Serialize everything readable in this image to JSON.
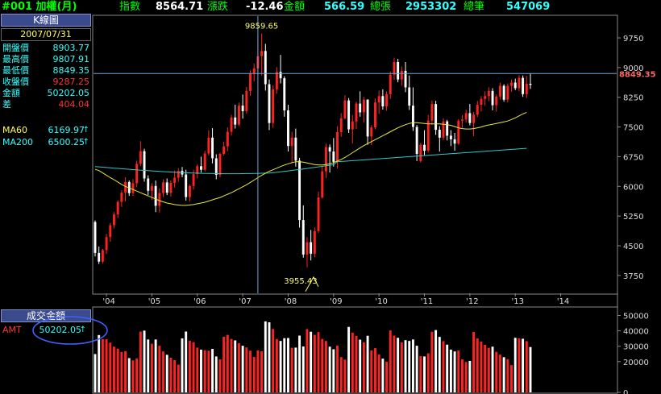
{
  "header": {
    "code_title": "#001 加權(月)",
    "index_label": "指數",
    "index_value": "8564.71",
    "change_label": "漲跌",
    "change_value": "-12.46",
    "amount_label": "金額",
    "amount_value": "566.59",
    "up_count_label": "總張",
    "up_count_value": "2953302",
    "trades_label": "總筆",
    "trades_value": "547069"
  },
  "info_panel": {
    "title": "K線圖",
    "date": "2007/07/31",
    "rows": [
      {
        "label": "開盤價",
        "value": "8903.77"
      },
      {
        "label": "最高價",
        "value": "9807.91"
      },
      {
        "label": "最低價",
        "value": "8849.35"
      },
      {
        "label": "收盤價",
        "value": "9287.25"
      },
      {
        "label": "金額",
        "value": "50202.05"
      },
      {
        "label": "差",
        "value": "404.04"
      }
    ],
    "ma60_label": "MA60",
    "ma60_value": "6169.97",
    "ma200_label": "MA200",
    "ma200_value": "6500.25",
    "arrow": "↑"
  },
  "volume_panel": {
    "title": "成交金額",
    "amt_label": "AMT",
    "amt_value": "50202.05",
    "arrow": "↑"
  },
  "colors": {
    "up": "#ff2222",
    "down": "#ffffff",
    "ma60": "#e8e840",
    "ma200": "#30c8c8",
    "grid": "#555555",
    "crosshair": "#6fa8dc",
    "annotation": "#ffff66",
    "highlight_ellipse": "#4060ff"
  },
  "chart_data": {
    "type": "candlestick",
    "price_axis": {
      "ticks": [
        3750,
        4500,
        5250,
        6000,
        6750,
        7500,
        8250,
        9000,
        9750
      ],
      "range": [
        3300,
        10300
      ]
    },
    "volume_axis": {
      "ticks": [
        0,
        20000,
        30000,
        40000,
        50000
      ],
      "range": [
        0,
        55000
      ]
    },
    "x_ticks": [
      "'04",
      "'05",
      "'06",
      "'07",
      "'08",
      "'09",
      "'10",
      "'11",
      "'12",
      "'13",
      "'14"
    ],
    "annotations": {
      "high": "9859.65",
      "low": "3955.43",
      "current_price": "8849.35"
    },
    "candles_ohlc": [
      [
        5100,
        5140,
        4230,
        4320
      ],
      [
        4320,
        4480,
        4040,
        4100
      ],
      [
        4100,
        4420,
        4050,
        4390
      ],
      [
        4390,
        4800,
        4290,
        4720
      ],
      [
        4720,
        5080,
        4600,
        5020
      ],
      [
        5020,
        5350,
        4940,
        5290
      ],
      [
        5290,
        5650,
        5200,
        5610
      ],
      [
        5610,
        5900,
        5480,
        5840
      ],
      [
        5840,
        6230,
        5620,
        6110
      ],
      [
        6110,
        6150,
        5760,
        5830
      ],
      [
        5830,
        6180,
        5760,
        6080
      ],
      [
        6080,
        6650,
        5980,
        6570
      ],
      [
        6570,
        7140,
        6510,
        6890
      ],
      [
        6890,
        6950,
        6120,
        6200
      ],
      [
        6200,
        6280,
        5780,
        5890
      ],
      [
        5890,
        6080,
        5660,
        6010
      ],
      [
        6010,
        6150,
        5350,
        5510
      ],
      [
        5510,
        5950,
        5340,
        5830
      ],
      [
        5830,
        6180,
        5730,
        6100
      ],
      [
        6100,
        6200,
        5780,
        5840
      ],
      [
        5840,
        6150,
        5740,
        6090
      ],
      [
        6090,
        6400,
        5970,
        6220
      ],
      [
        6220,
        6460,
        6120,
        6390
      ],
      [
        6390,
        6490,
        6230,
        6300
      ],
      [
        6300,
        6420,
        5640,
        5730
      ],
      [
        5730,
        6050,
        5620,
        6010
      ],
      [
        6010,
        6420,
        5920,
        6310
      ],
      [
        6310,
        6560,
        6200,
        6510
      ],
      [
        6510,
        6750,
        6350,
        6420
      ],
      [
        6420,
        6900,
        6380,
        6830
      ],
      [
        6830,
        7420,
        6780,
        7230
      ],
      [
        7230,
        7470,
        6580,
        6710
      ],
      [
        6710,
        6810,
        6180,
        6290
      ],
      [
        6290,
        6850,
        6230,
        6820
      ],
      [
        6820,
        7130,
        6780,
        7010
      ],
      [
        7010,
        7490,
        6890,
        7380
      ],
      [
        7380,
        7810,
        7280,
        7740
      ],
      [
        7740,
        8060,
        7460,
        7560
      ],
      [
        7560,
        8120,
        7520,
        8040
      ],
      [
        8040,
        8320,
        7710,
        7900
      ],
      [
        7900,
        8510,
        7840,
        8410
      ],
      [
        8410,
        8930,
        8290,
        8850
      ],
      [
        8850,
        9100,
        8650,
        8980
      ],
      [
        8980,
        9808,
        8850,
        9287
      ],
      [
        9290,
        9860,
        8800,
        9420
      ],
      [
        9420,
        9600,
        8420,
        8580
      ],
      [
        8580,
        8700,
        7420,
        7600
      ],
      [
        7600,
        8550,
        7480,
        8450
      ],
      [
        8450,
        9010,
        8340,
        8890
      ],
      [
        8890,
        9320,
        8600,
        8730
      ],
      [
        8730,
        8780,
        7760,
        7920
      ],
      [
        7920,
        8060,
        6880,
        7020
      ],
      [
        7020,
        7380,
        6580,
        7230
      ],
      [
        7230,
        7460,
        6500,
        6650
      ],
      [
        6650,
        6720,
        4960,
        5150
      ],
      [
        5150,
        5520,
        4200,
        4280
      ],
      [
        4280,
        4720,
        3955,
        4590
      ],
      [
        4590,
        4900,
        4130,
        4300
      ],
      [
        4300,
        4960,
        4210,
        4870
      ],
      [
        4870,
        5870,
        4820,
        5720
      ],
      [
        5720,
        6520,
        5690,
        6380
      ],
      [
        6380,
        7080,
        6210,
        6990
      ],
      [
        6990,
        7060,
        6350,
        6880
      ],
      [
        6880,
        7220,
        6500,
        6620
      ],
      [
        6620,
        7520,
        6450,
        7370
      ],
      [
        7370,
        7850,
        7250,
        7720
      ],
      [
        7720,
        8300,
        7690,
        8170
      ],
      [
        8170,
        8230,
        7350,
        7440
      ],
      [
        7440,
        7800,
        7080,
        7640
      ],
      [
        7640,
        8140,
        7450,
        8090
      ],
      [
        8090,
        8400,
        7760,
        7870
      ],
      [
        7870,
        8260,
        7610,
        8190
      ],
      [
        8190,
        8200,
        7050,
        7260
      ],
      [
        7260,
        7550,
        7040,
        7490
      ],
      [
        7490,
        8220,
        7440,
        8120
      ],
      [
        8120,
        8420,
        7830,
        8280
      ],
      [
        8280,
        8450,
        7940,
        8020
      ],
      [
        8020,
        8400,
        7910,
        8330
      ],
      [
        8330,
        8900,
        8210,
        8820
      ],
      [
        8820,
        9250,
        8690,
        9140
      ],
      [
        9140,
        9220,
        8630,
        8700
      ],
      [
        8700,
        9030,
        8540,
        8920
      ],
      [
        8920,
        9140,
        8380,
        8500
      ],
      [
        8500,
        8800,
        7930,
        8040
      ],
      [
        8040,
        8500,
        7400,
        7500
      ],
      [
        7500,
        7550,
        6640,
        6820
      ],
      [
        6640,
        7100,
        6600,
        7050
      ],
      [
        7050,
        7420,
        6790,
        6900
      ],
      [
        6900,
        7800,
        6850,
        7660
      ],
      [
        7660,
        8170,
        7550,
        8080
      ],
      [
        8080,
        8160,
        7300,
        7430
      ],
      [
        7430,
        7520,
        6880,
        7230
      ],
      [
        7230,
        7720,
        7160,
        7640
      ],
      [
        7640,
        7680,
        7160,
        7280
      ],
      [
        7280,
        7420,
        7020,
        7190
      ],
      [
        7190,
        7350,
        6900,
        7080
      ],
      [
        7080,
        7700,
        7050,
        7660
      ],
      [
        7660,
        7800,
        7480,
        7690
      ],
      [
        7690,
        7940,
        7610,
        7850
      ],
      [
        7850,
        8080,
        7540,
        7600
      ],
      [
        7600,
        7880,
        7270,
        7810
      ],
      [
        7810,
        8160,
        7750,
        8060
      ],
      [
        8060,
        8280,
        7890,
        8210
      ],
      [
        8210,
        8400,
        8040,
        8280
      ],
      [
        8280,
        8500,
        8150,
        8410
      ],
      [
        8410,
        8480,
        7920,
        8050
      ],
      [
        8050,
        8320,
        7890,
        8270
      ],
      [
        8270,
        8620,
        8190,
        8540
      ],
      [
        8540,
        8580,
        8140,
        8190
      ],
      [
        8190,
        8600,
        8120,
        8540
      ],
      [
        8540,
        8700,
        8390,
        8620
      ],
      [
        8620,
        8720,
        8430,
        8480
      ],
      [
        8480,
        8810,
        8400,
        8740
      ],
      [
        8740,
        8800,
        8260,
        8330
      ],
      [
        8330,
        8790,
        8230,
        8590
      ],
      [
        8590,
        8850,
        8460,
        8565
      ]
    ],
    "ma60": [
      6430,
      6400,
      6340,
      6280,
      6220,
      6170,
      6110,
      6050,
      6000,
      5960,
      5920,
      5880,
      5840,
      5800,
      5760,
      5720,
      5680,
      5640,
      5610,
      5580,
      5560,
      5540,
      5530,
      5520,
      5520,
      5530,
      5540,
      5560,
      5580,
      5600,
      5630,
      5660,
      5690,
      5720,
      5760,
      5800,
      5840,
      5890,
      5940,
      5990,
      6040,
      6100,
      6160,
      6220,
      6280,
      6330,
      6380,
      6420,
      6460,
      6500,
      6540,
      6570,
      6600,
      6620,
      6620,
      6610,
      6590,
      6570,
      6550,
      6540,
      6540,
      6550,
      6570,
      6600,
      6640,
      6680,
      6730,
      6790,
      6850,
      6910,
      6970,
      7030,
      7080,
      7130,
      7180,
      7230,
      7280,
      7330,
      7380,
      7430,
      7480,
      7520,
      7560,
      7590,
      7610,
      7610,
      7600,
      7590,
      7580,
      7580,
      7580,
      7580,
      7570,
      7560,
      7540,
      7510,
      7480,
      7460,
      7450,
      7450,
      7460,
      7480,
      7500,
      7530,
      7550,
      7570,
      7590,
      7610,
      7630,
      7650,
      7690,
      7730,
      7780,
      7830,
      7870
    ]
  }
}
